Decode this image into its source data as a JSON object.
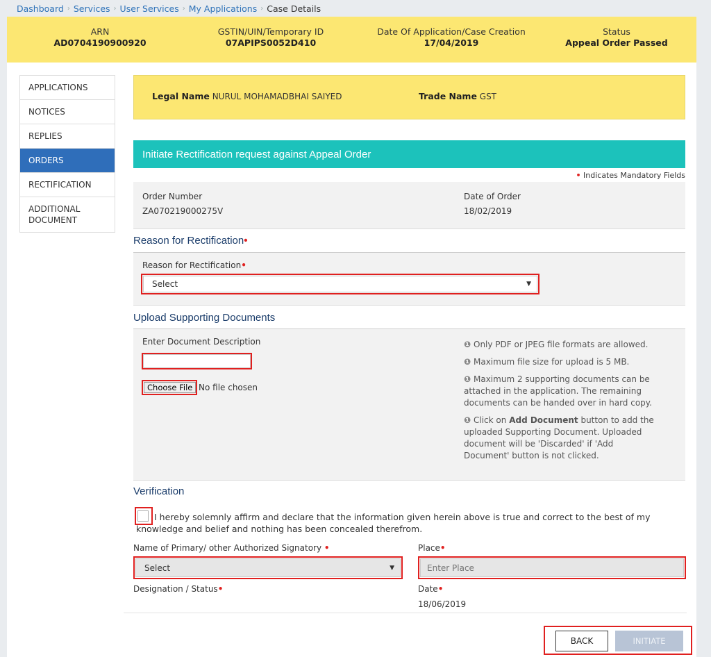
{
  "breadcrumb": {
    "items": [
      "Dashboard",
      "Services",
      "User Services",
      "My Applications"
    ],
    "current": "Case Details"
  },
  "case_header": {
    "arn_label": "ARN",
    "arn_value": "AD0704190900920",
    "gstin_label": "GSTIN/UIN/Temporary ID",
    "gstin_value": "07APIPS0052D410",
    "date_label": "Date Of Application/Case Creation",
    "date_value": "17/04/2019",
    "status_label": "Status",
    "status_value": "Appeal Order Passed"
  },
  "sidebar": {
    "items": [
      {
        "label": "APPLICATIONS",
        "active": false
      },
      {
        "label": "NOTICES",
        "active": false
      },
      {
        "label": "REPLIES",
        "active": false
      },
      {
        "label": "ORDERS",
        "active": true
      },
      {
        "label": "RECTIFICATION",
        "active": false
      },
      {
        "label": "ADDITIONAL DOCUMENT",
        "active": false
      }
    ]
  },
  "legal": {
    "legal_name_label": "Legal Name",
    "legal_name_value": "NURUL MOHAMADBHAI SAIYED",
    "trade_name_label": "Trade Name",
    "trade_name_value": "GST"
  },
  "form": {
    "header": "Initiate Rectification request against Appeal Order",
    "mandatory_note": "Indicates Mandatory Fields",
    "order_number_label": "Order Number",
    "order_number_value": "ZA070219000275V",
    "order_date_label": "Date of Order",
    "order_date_value": "18/02/2019",
    "reason_section_title": "Reason for Rectification",
    "reason_field_label": "Reason for Rectification",
    "reason_select_value": "Select",
    "upload_section_title": "Upload Supporting Documents",
    "doc_desc_label": "Enter Document Description",
    "doc_desc_value": "",
    "choose_file_label": "Choose File",
    "no_file_text": "No file chosen",
    "info": [
      "Only PDF or JPEG file formats are allowed.",
      "Maximum file size for upload is 5 MB.",
      "Maximum 2 supporting documents can be attached in the application. The remaining documents can be handed over in hard copy."
    ],
    "info4_pre": "Click on",
    "info4_bold": "Add Document",
    "info4_post": "button to add the uploaded Supporting Document. Uploaded document will be 'Discarded' if 'Add Document' button is not clicked.",
    "verification_title": "Verification",
    "declaration": "I hereby solemnly affirm and declare that the information given herein above is true and correct to the best of my knowledge and belief and nothing has been concealed therefrom.",
    "signatory_label": "Name of Primary/ other Authorized Signatory",
    "signatory_value": "Select",
    "place_label": "Place",
    "place_placeholder": "Enter Place",
    "designation_label": "Designation / Status",
    "date_label": "Date",
    "date_value": "18/06/2019"
  },
  "buttons": {
    "back": "BACK",
    "initiate": "INITIATE"
  },
  "colors": {
    "header_yellow": "#fce772",
    "teal": "#1cc2bb",
    "active_nav": "#2f6eba",
    "highlight_red": "#e0201f"
  }
}
